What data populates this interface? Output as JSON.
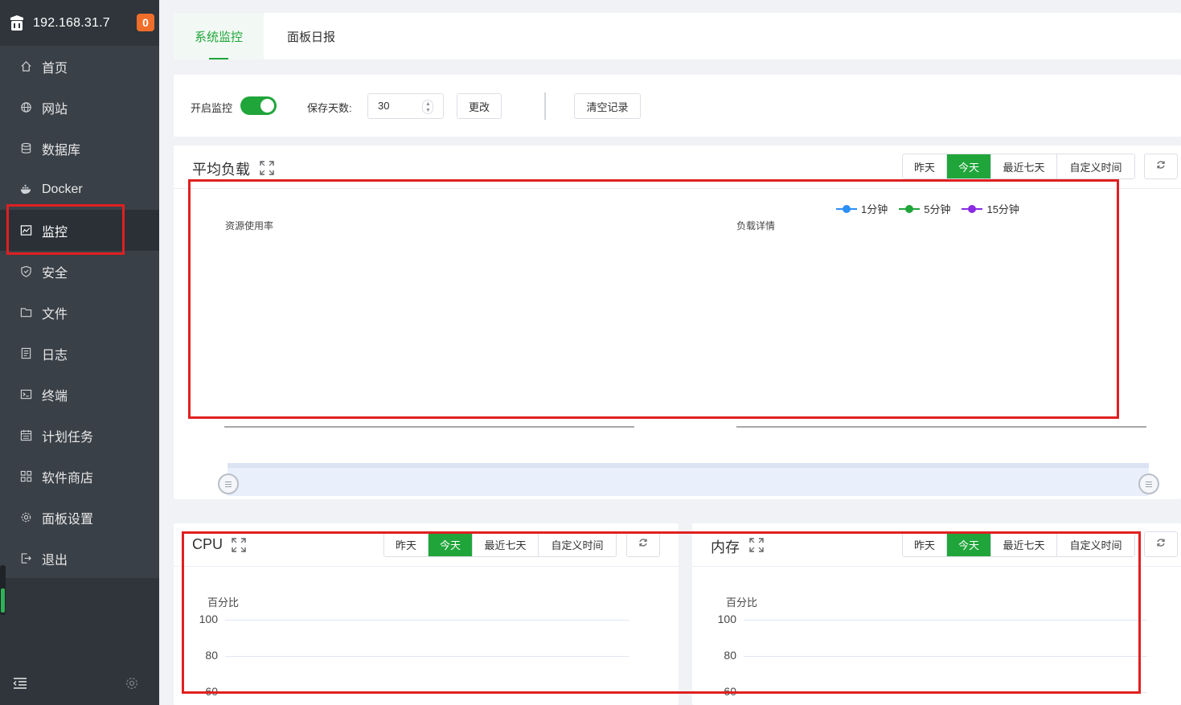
{
  "sidebar": {
    "server_ip": "192.168.31.7",
    "notification_count": "0",
    "items": [
      {
        "label": "首页",
        "icon": "home-icon"
      },
      {
        "label": "网站",
        "icon": "globe-icon"
      },
      {
        "label": "数据库",
        "icon": "database-icon"
      },
      {
        "label": "Docker",
        "icon": "docker-icon"
      },
      {
        "label": "监控",
        "icon": "monitor-icon",
        "active": true
      },
      {
        "label": "安全",
        "icon": "shield-icon"
      },
      {
        "label": "文件",
        "icon": "folder-icon"
      },
      {
        "label": "日志",
        "icon": "log-icon"
      },
      {
        "label": "终端",
        "icon": "terminal-icon"
      },
      {
        "label": "计划任务",
        "icon": "calendar-icon"
      },
      {
        "label": "软件商店",
        "icon": "apps-icon"
      },
      {
        "label": "面板设置",
        "icon": "gear-icon"
      },
      {
        "label": "退出",
        "icon": "logout-icon"
      }
    ]
  },
  "tabs": [
    {
      "label": "系统监控",
      "active": true
    },
    {
      "label": "面板日报",
      "active": false
    }
  ],
  "controls": {
    "monitor_toggle_label": "开启监控",
    "monitor_enabled": true,
    "retention_label": "保存天数:",
    "retention_value": "30",
    "change_button": "更改",
    "clear_button": "清空记录"
  },
  "range_buttons": [
    "昨天",
    "今天",
    "最近七天",
    "自定义时间"
  ],
  "active_range": "今天",
  "load_panel": {
    "title": "平均负载",
    "left_chart_title": "资源使用率",
    "right_chart_title": "负载详情",
    "legend": [
      {
        "name": "1分钟",
        "color": "#2a8ff7"
      },
      {
        "name": "5分钟",
        "color": "#20a53a"
      },
      {
        "name": "15分钟",
        "color": "#8a2be2"
      }
    ]
  },
  "cpu_panel": {
    "title": "CPU",
    "y_axis_label": "百分比",
    "ticks": [
      "100",
      "80",
      "60"
    ]
  },
  "memory_panel": {
    "title": "内存",
    "y_axis_label": "百分比",
    "ticks": [
      "100",
      "80",
      "60"
    ]
  },
  "colors": {
    "accent": "#20a53a",
    "sidebar_bg": "#3a4047",
    "badge": "#f06e2a",
    "annotation": "#e02020"
  }
}
